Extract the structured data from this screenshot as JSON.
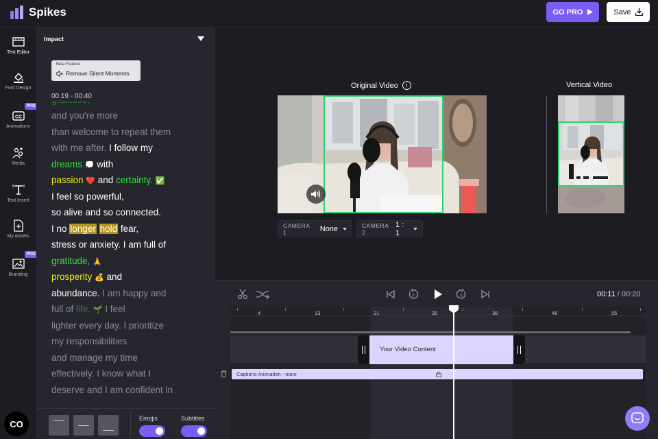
{
  "app": {
    "name": "Spikes"
  },
  "header": {
    "go_pro_label": "GO PRO",
    "save_label": "Save"
  },
  "rail": {
    "items": [
      {
        "label": "Text Editor",
        "icon": "film-icon",
        "active": true,
        "pro": false
      },
      {
        "label": "Font Design",
        "icon": "paint-bucket-icon",
        "active": false,
        "pro": false
      },
      {
        "label": "Animations",
        "icon": "cc-icon",
        "active": false,
        "pro": true
      },
      {
        "label": "Media",
        "icon": "media-icon",
        "active": false,
        "pro": false
      },
      {
        "label": "Text Insert",
        "icon": "text-insert-icon",
        "active": false,
        "pro": false
      },
      {
        "label": "My Assets",
        "icon": "assets-icon",
        "active": false,
        "pro": false
      },
      {
        "label": "Branding",
        "icon": "branding-icon",
        "active": false,
        "pro": true
      }
    ],
    "pro_badge": "PRO",
    "brand_logo": "CO"
  },
  "editor": {
    "style_name": "Impact",
    "beta_label": "Beta Feature",
    "beta_action": "Remove Silent Moments",
    "time_range": "00:19 - 00:40",
    "toggles": {
      "emojis_label": "Emojis",
      "subtitles_label": "Subtitles",
      "emojis_on": true,
      "subtitles_on": true
    }
  },
  "transcript": {
    "l1": "and you're more",
    "l2": "than welcome to repeat them",
    "l3a": "with me after.",
    "l3b": "I follow my",
    "l4a": "dreams",
    "l4b": "with",
    "l5a": "passion",
    "l5b": "and",
    "l5c": "certainty.",
    "l6": "I feel so powerful,",
    "l7": "so alive and so connected.",
    "l8a": "I no",
    "l8b": "longer",
    "l8c": "hold",
    "l8d": "fear,",
    "l9": "stress or anxiety. I am full of",
    "l10": "gratitude,",
    "l11a": "prosperity",
    "l11b": "and",
    "l12a": "abundance.",
    "l12b": "I am happy and",
    "l13a": "full of",
    "l13b": "life.",
    "l13c": "I feel",
    "l14": "lighter every day. I prioritize",
    "l15": "my responsibilities",
    "l16": "and manage my time",
    "l17": "effectively. I know what I",
    "l18": "deserve and I am confident in"
  },
  "preview": {
    "original_title": "Original Video",
    "vertical_title": "Vertical Video",
    "camera1_label": "CAMERA 1",
    "camera1_value": "None",
    "camera2_label": "CAMERA 2",
    "camera2_value": "1 : 1"
  },
  "timeline": {
    "current_time": "00:11",
    "separator": " / ",
    "total_time": "00:20",
    "ticks": [
      "4",
      "13",
      "21",
      "30",
      "38",
      "46",
      "55"
    ],
    "clip_label": "Your Video Content",
    "captions_label": "Captions Animation - none"
  },
  "colors": {
    "accent": "#7b5cf5",
    "keyword_green": "#2ee53a",
    "keyword_yellow": "#f5f000",
    "highlight": "#b69620",
    "crop_frame": "#2fd26e"
  }
}
